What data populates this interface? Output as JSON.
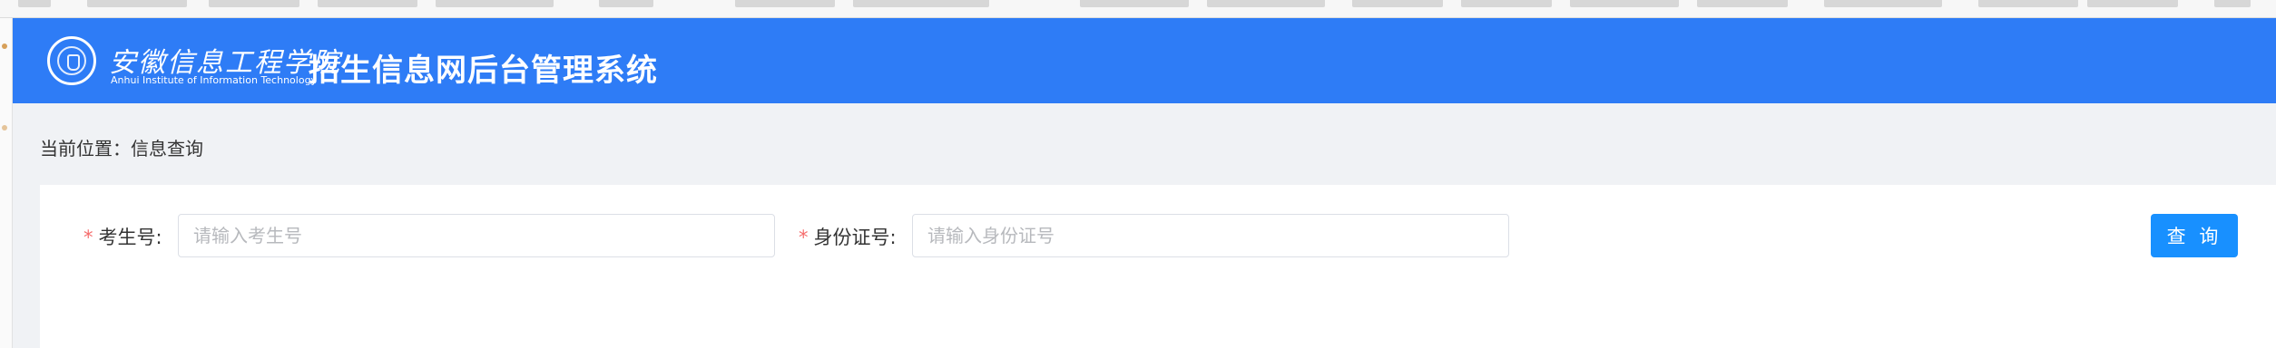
{
  "header": {
    "logo_chinese": "安徽信息工程学院",
    "logo_english": "Anhui Institute of Information Technology",
    "system_title": "招生信息网后台管理系统"
  },
  "breadcrumb": {
    "prefix": "当前位置：",
    "current": "信息查询"
  },
  "search_form": {
    "required_mark": "*",
    "exam_number": {
      "label": "考生号:",
      "placeholder": "请输入考生号",
      "value": ""
    },
    "id_number": {
      "label": "身份证号:",
      "placeholder": "请输入身份证号",
      "value": ""
    },
    "query_button_label": "查 询"
  },
  "colors": {
    "header_blue": "#2e7cf6",
    "button_blue": "#1890ff",
    "required_red": "#f56c6c",
    "page_background": "#f0f2f5"
  }
}
